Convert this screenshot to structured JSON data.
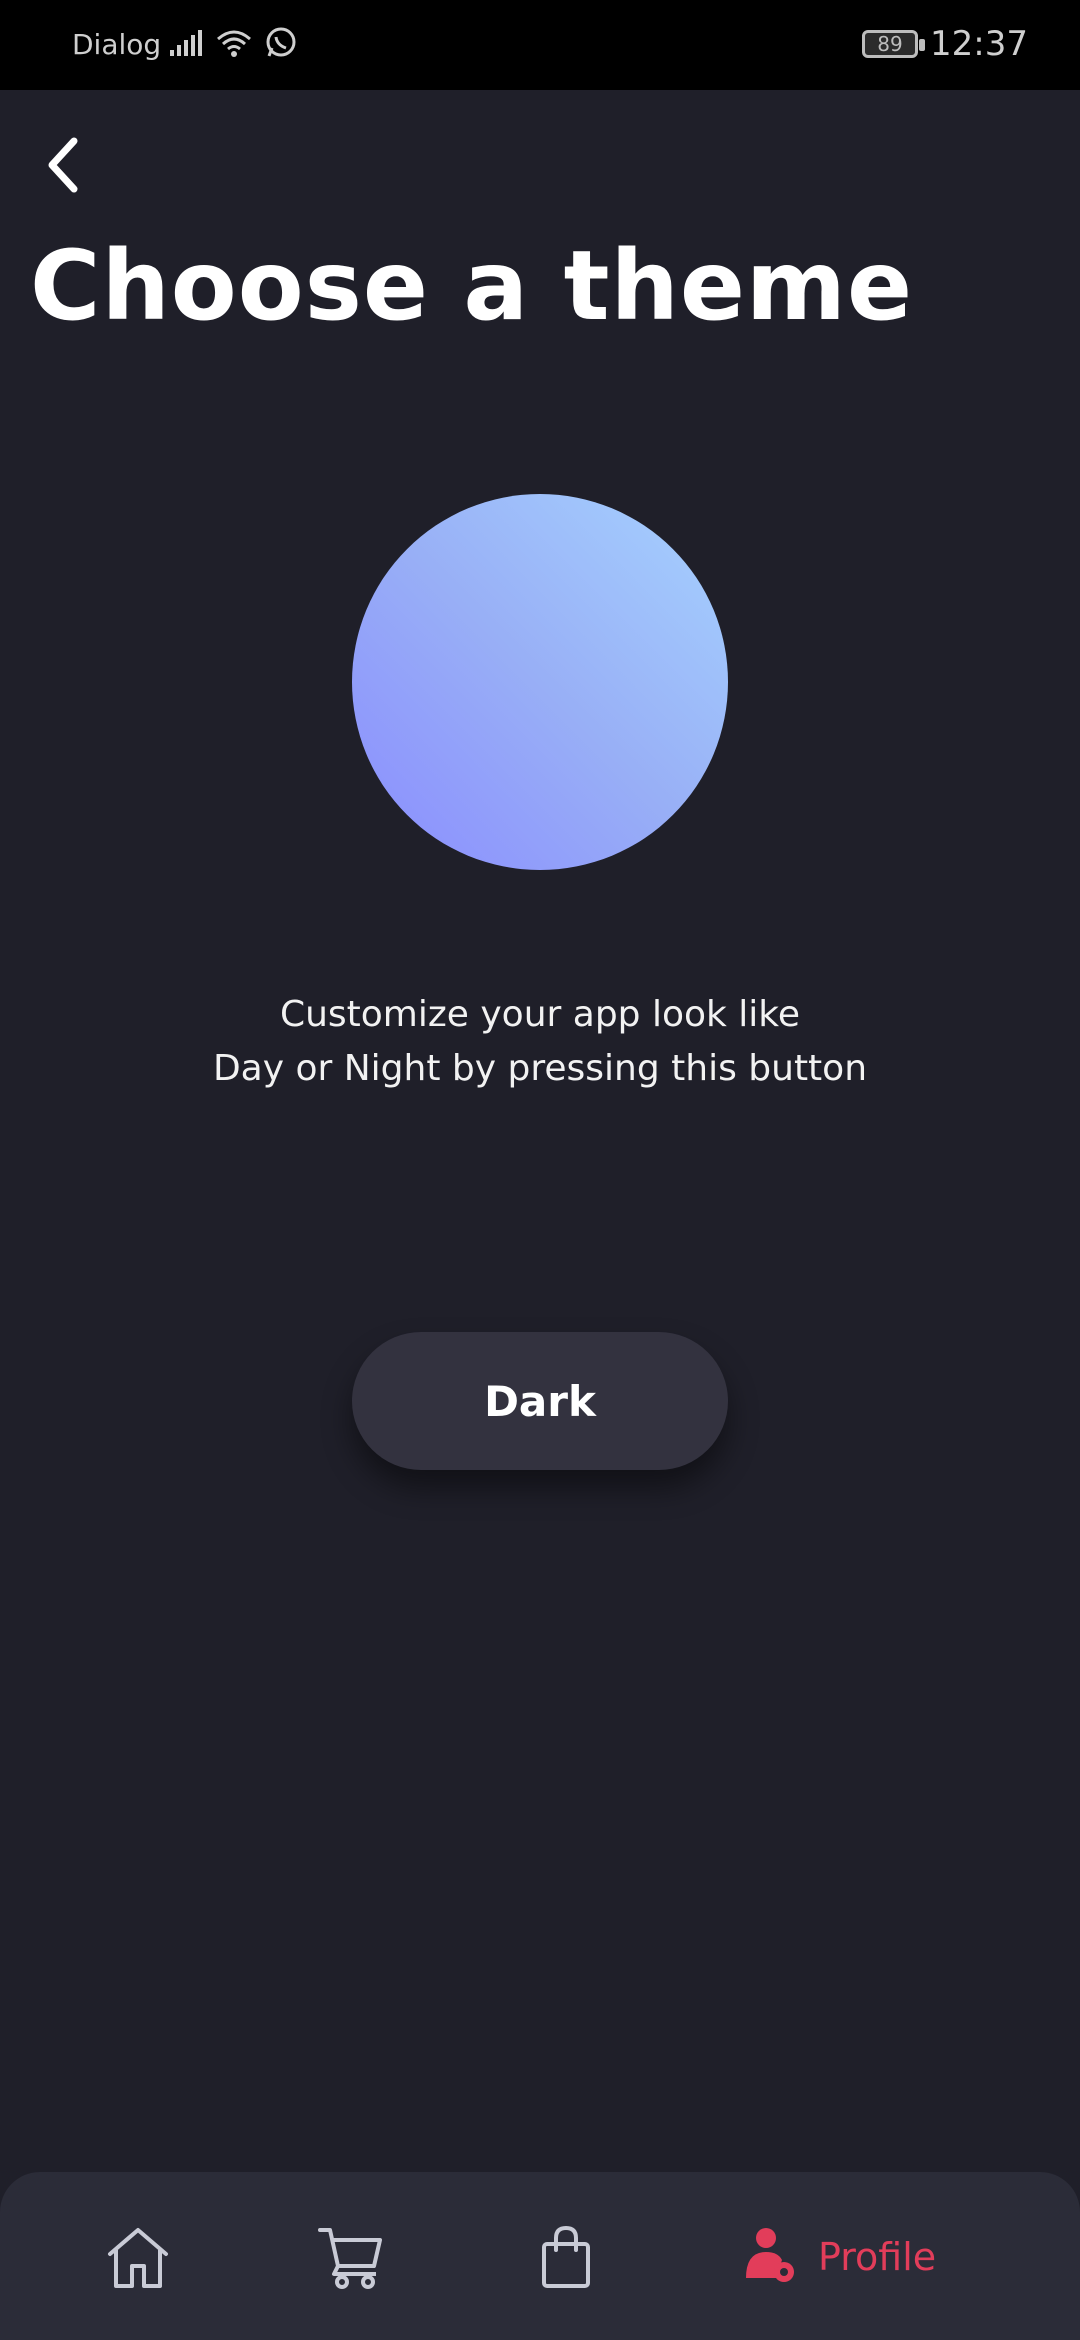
{
  "status_bar": {
    "carrier": "Dialog",
    "battery": "89",
    "time": "12:37",
    "icons": [
      "signal-icon",
      "wifi-icon",
      "whatsapp-icon"
    ]
  },
  "header": {
    "back_icon": "chevron-left-icon",
    "title": "Choose a theme"
  },
  "theme_preview": {
    "gradient_colors": [
      "#8a8cff",
      "#a6d2ff"
    ]
  },
  "description": {
    "line1": "Customize your app look like",
    "line2": "Day or Night by pressing this button"
  },
  "theme_button": {
    "label": "Dark"
  },
  "bottom_nav": {
    "items": [
      {
        "icon": "home-icon",
        "label": ""
      },
      {
        "icon": "cart-icon",
        "label": ""
      },
      {
        "icon": "shopping-bag-icon",
        "label": ""
      },
      {
        "icon": "user-settings-icon",
        "label": "Profile",
        "active": true
      }
    ],
    "active_color": "#e23d5a",
    "inactive_color": "#c9cbd6"
  },
  "colors": {
    "background": "#1f1f29",
    "button_bg": "#33323f",
    "nav_bg": "#2b2c38"
  }
}
